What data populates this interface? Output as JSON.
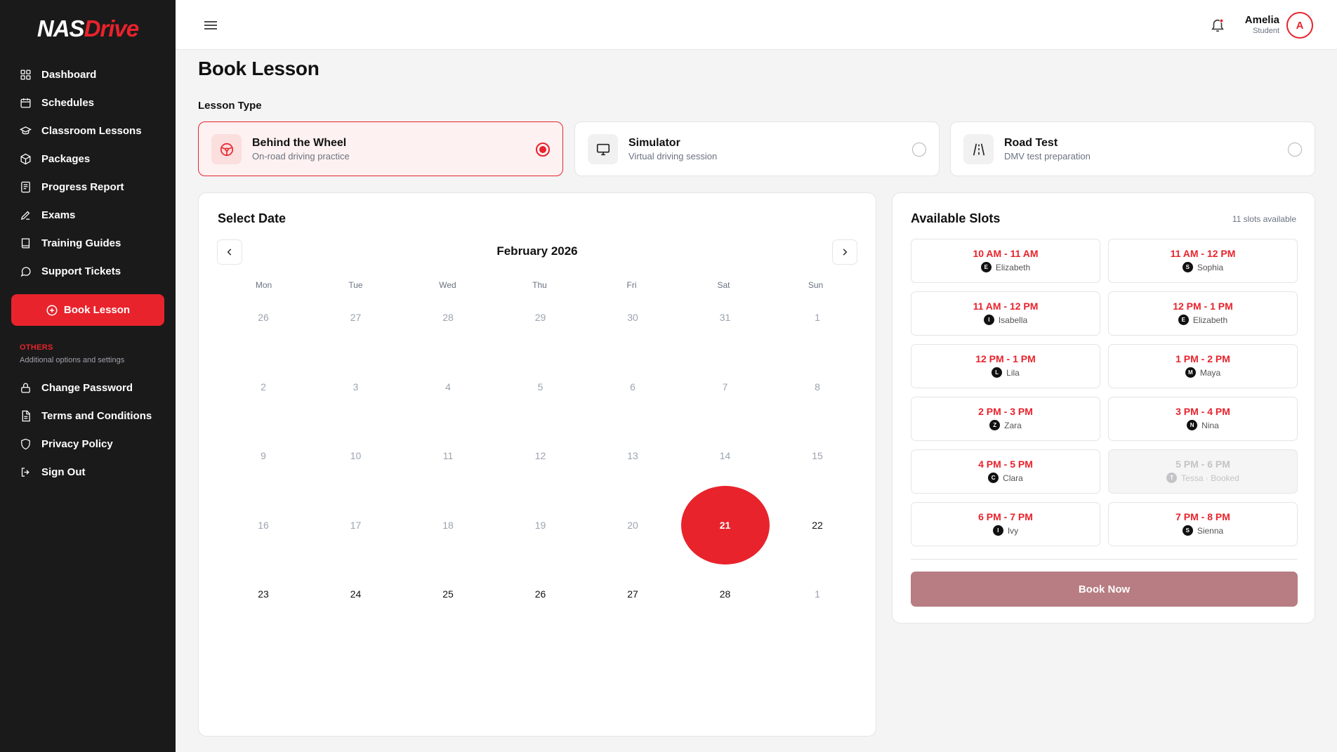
{
  "brand": {
    "logo_part1": "NAS",
    "logo_part2": "Drive",
    "accent": "#e8232c"
  },
  "sidebar": {
    "items": [
      {
        "label": "Dashboard",
        "icon": "dashboard-icon"
      },
      {
        "label": "Schedules",
        "icon": "calendar-icon"
      },
      {
        "label": "Classroom Lessons",
        "icon": "graduation-cap-icon"
      },
      {
        "label": "Packages",
        "icon": "package-icon"
      },
      {
        "label": "Progress Report",
        "icon": "report-icon"
      },
      {
        "label": "Exams",
        "icon": "pen-icon"
      },
      {
        "label": "Training Guides",
        "icon": "book-icon"
      },
      {
        "label": "Support Tickets",
        "icon": "chat-icon"
      }
    ],
    "cta_label": "Book Lesson",
    "others_title": "OTHERS",
    "others_subtitle": "Additional options and settings",
    "other_items": [
      {
        "label": "Change Password",
        "icon": "lock-icon"
      },
      {
        "label": "Terms and Conditions",
        "icon": "document-icon"
      },
      {
        "label": "Privacy Policy",
        "icon": "shield-icon"
      },
      {
        "label": "Sign Out",
        "icon": "sign-out-icon"
      }
    ]
  },
  "header": {
    "user_name": "Amelia",
    "user_role": "Student",
    "avatar_initial": "A"
  },
  "main": {
    "title": "Book Lesson",
    "lesson_type_label": "Lesson Type",
    "lesson_types": [
      {
        "title": "Behind the Wheel",
        "subtitle": "On-road driving practice",
        "selected": true,
        "icon": "steering-wheel-icon"
      },
      {
        "title": "Simulator",
        "subtitle": "Virtual driving session",
        "selected": false,
        "icon": "monitor-icon"
      },
      {
        "title": "Road Test",
        "subtitle": "DMV test preparation",
        "selected": false,
        "icon": "road-icon"
      }
    ]
  },
  "calendar": {
    "title": "Select Date",
    "month_label": "February 2026",
    "weekdays": [
      "Mon",
      "Tue",
      "Wed",
      "Thu",
      "Fri",
      "Sat",
      "Sun"
    ],
    "weeks": [
      [
        "26",
        "27",
        "28",
        "29",
        "30",
        "31",
        "1"
      ],
      [
        "2",
        "3",
        "4",
        "5",
        "6",
        "7",
        "8"
      ],
      [
        "9",
        "10",
        "11",
        "12",
        "13",
        "14",
        "15"
      ],
      [
        "16",
        "17",
        "18",
        "19",
        "20",
        "21",
        "22"
      ],
      [
        "23",
        "24",
        "25",
        "26",
        "27",
        "28",
        "1"
      ]
    ],
    "selected_day": "21"
  },
  "slots": {
    "title": "Available Slots",
    "count_label": "11 slots available",
    "items": [
      {
        "time": "10 AM - 11 AM",
        "instructor": "Elizabeth",
        "initial": "E",
        "booked": false
      },
      {
        "time": "11 AM - 12 PM",
        "instructor": "Sophia",
        "initial": "S",
        "booked": false
      },
      {
        "time": "11 AM - 12 PM",
        "instructor": "Isabella",
        "initial": "I",
        "booked": false
      },
      {
        "time": "12 PM - 1 PM",
        "instructor": "Elizabeth",
        "initial": "E",
        "booked": false
      },
      {
        "time": "12 PM - 1 PM",
        "instructor": "Lila",
        "initial": "L",
        "booked": false
      },
      {
        "time": "1 PM - 2 PM",
        "instructor": "Maya",
        "initial": "M",
        "booked": false
      },
      {
        "time": "2 PM - 3 PM",
        "instructor": "Zara",
        "initial": "Z",
        "booked": false
      },
      {
        "time": "3 PM - 4 PM",
        "instructor": "Nina",
        "initial": "N",
        "booked": false
      },
      {
        "time": "4 PM - 5 PM",
        "instructor": "Clara",
        "initial": "C",
        "booked": false
      },
      {
        "time": "5 PM - 6 PM",
        "instructor": "Tessa · Booked",
        "initial": "T",
        "booked": true
      },
      {
        "time": "6 PM - 7 PM",
        "instructor": "Ivy",
        "initial": "I",
        "booked": false
      },
      {
        "time": "7 PM - 8 PM",
        "instructor": "Sienna",
        "initial": "S",
        "booked": false
      }
    ],
    "book_now_label": "Book Now"
  }
}
